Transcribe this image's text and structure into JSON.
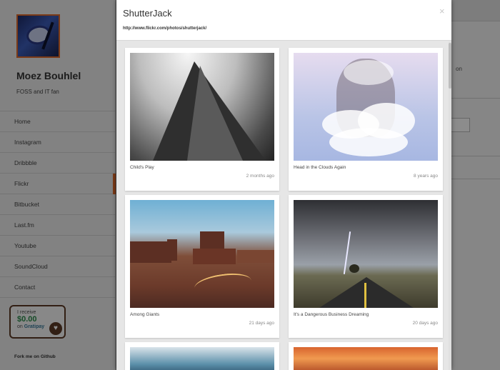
{
  "sidebar": {
    "profile_name": "Moez Bouhlel",
    "profile_bio": "FOSS and IT fan",
    "nav": [
      "Home",
      "Instagram",
      "Dribbble",
      "Flickr",
      "Bitbucket",
      "Last.fm",
      "Youtube",
      "SoundCloud",
      "Contact"
    ],
    "active_item": "Flickr",
    "gratipay": {
      "line1": "I receive",
      "amount": "$0.00",
      "line3_prefix": "on",
      "line3_brand": "Gratipay"
    },
    "fork_link": "Fork me on Github"
  },
  "background_page": {
    "text_fragment": "on"
  },
  "modal": {
    "title": "ShutterJack",
    "url": "http://www.flickr.com/photos/shutterjack/",
    "close_glyph": "×",
    "photos": [
      {
        "caption": "Child's Play",
        "time": "2 months ago"
      },
      {
        "caption": "Head in the Clouds Again",
        "time": "8 years ago"
      },
      {
        "caption": "Among Giants",
        "time": "21 days ago"
      },
      {
        "caption": "It's a Dangerous Business Dreaming",
        "time": "20 days ago"
      }
    ]
  },
  "colors": {
    "accent": "#e06a2a",
    "overlay": "rgba(0,0,0,0.45)"
  }
}
